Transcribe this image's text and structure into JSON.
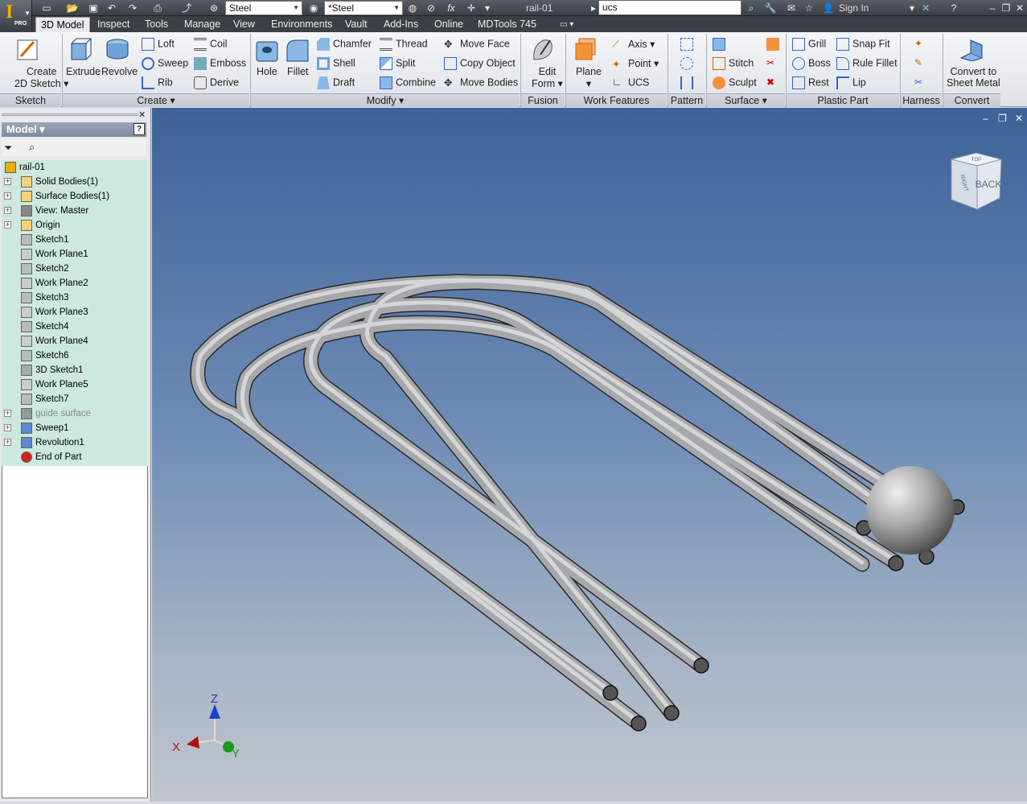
{
  "app": {
    "edition": "PRO",
    "doc_title": "rail-01",
    "search_value": "ucs",
    "sign_in": "Sign In"
  },
  "qat": {
    "material": "Steel",
    "appearance": "*Steel"
  },
  "tabs": [
    "3D Model",
    "Inspect",
    "Tools",
    "Manage",
    "View",
    "Environments",
    "Vault",
    "Add-Ins",
    "Online",
    "MDTools 745"
  ],
  "ribbon": {
    "sketch": {
      "create": "Create",
      "create2": "2D Sketch",
      "panel": "Sketch"
    },
    "create": {
      "extrude": "Extrude",
      "revolve": "Revolve",
      "loft": "Loft",
      "sweep": "Sweep",
      "rib": "Rib",
      "coil": "Coil",
      "emboss": "Emboss",
      "derive": "Derive",
      "panel": "Create"
    },
    "modify": {
      "hole": "Hole",
      "fillet": "Fillet",
      "chamfer": "Chamfer",
      "shell": "Shell",
      "draft": "Draft",
      "thread": "Thread",
      "split": "Split",
      "combine": "Combine",
      "moveface": "Move Face",
      "copyobject": "Copy Object",
      "movebodies": "Move Bodies",
      "panel": "Modify"
    },
    "fusion": {
      "edit": "Edit",
      "form": "Form",
      "panel": "Fusion"
    },
    "work": {
      "plane": "Plane",
      "axis": "Axis",
      "point": "Point",
      "ucs": "UCS",
      "panel": "Work Features"
    },
    "pattern": {
      "panel": "Pattern"
    },
    "surface": {
      "stitch": "Stitch",
      "sculpt": "Sculpt",
      "panel": "Surface"
    },
    "plastic": {
      "grill": "Grill",
      "boss": "Boss",
      "rest": "Rest",
      "snapfit": "Snap Fit",
      "rulefillet": "Rule Fillet",
      "lip": "Lip",
      "panel": "Plastic Part"
    },
    "harness": {
      "panel": "Harness"
    },
    "convert": {
      "l1": "Convert to",
      "l2": "Sheet Metal",
      "panel": "Convert"
    }
  },
  "browser": {
    "title": "Model",
    "nodes": [
      {
        "label": "rail-01",
        "exp": false,
        "indent": 0,
        "icon": "part-icon"
      },
      {
        "label": "Solid Bodies(1)",
        "exp": true,
        "icon": "folder-icon"
      },
      {
        "label": "Surface Bodies(1)",
        "exp": true,
        "icon": "folder-icon"
      },
      {
        "label": "View: Master",
        "exp": true,
        "icon": "view-icon"
      },
      {
        "label": "Origin",
        "exp": true,
        "icon": "folder-icon"
      },
      {
        "label": "Sketch1",
        "exp": false,
        "icon": "sketch-icon"
      },
      {
        "label": "Work Plane1",
        "exp": false,
        "icon": "workplane-icon"
      },
      {
        "label": "Sketch2",
        "exp": false,
        "icon": "sketch-icon"
      },
      {
        "label": "Work Plane2",
        "exp": false,
        "icon": "workplane-icon"
      },
      {
        "label": "Sketch3",
        "exp": false,
        "icon": "sketch-icon"
      },
      {
        "label": "Work Plane3",
        "exp": false,
        "icon": "workplane-icon"
      },
      {
        "label": "Sketch4",
        "exp": false,
        "icon": "sketch-icon"
      },
      {
        "label": "Work Plane4",
        "exp": false,
        "icon": "workplane-icon"
      },
      {
        "label": "Sketch6",
        "exp": false,
        "icon": "sketch-icon"
      },
      {
        "label": "3D Sketch1",
        "exp": false,
        "icon": "sketch3d-icon"
      },
      {
        "label": "Work Plane5",
        "exp": false,
        "icon": "workplane-icon"
      },
      {
        "label": "Sketch7",
        "exp": false,
        "icon": "sketch-icon"
      },
      {
        "label": "guide surface",
        "exp": true,
        "icon": "surface-icon",
        "dim": true
      },
      {
        "label": "Sweep1",
        "exp": true,
        "icon": "sweep-icon"
      },
      {
        "label": "Revolution1",
        "exp": true,
        "icon": "revolve-icon"
      },
      {
        "label": "End of Part",
        "exp": false,
        "icon": "endofpart-icon"
      }
    ]
  },
  "viewcube": {
    "face": "BACK",
    "side": "RIGHT",
    "top": "TOP"
  },
  "triad": {
    "x": "X",
    "y": "Y",
    "z": "Z"
  }
}
